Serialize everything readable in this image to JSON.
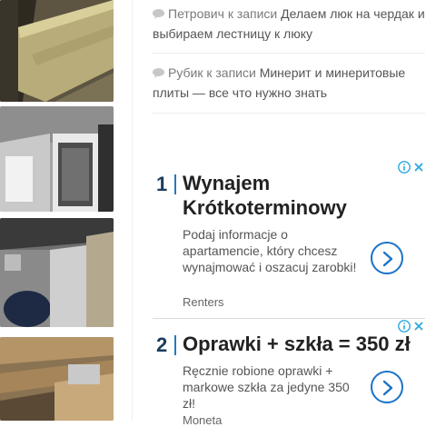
{
  "comments": [
    {
      "author": "Петрович",
      "connector": "к записи",
      "post_line1": "Делаем люк на чердак и",
      "post_line2": "выбираем лестницу к люку"
    },
    {
      "author": "Рубик",
      "connector": "к записи",
      "post_line1": "Минерит и минеритовые",
      "post_line2": "плиты — все что нужно знать"
    }
  ],
  "ads": [
    {
      "number": "1",
      "title_line1": "Wynajem",
      "title_line2": "Krótkoterminowy",
      "desc_line1": "Podaj informacje o",
      "desc_line2": "apartamencie, który chcesz",
      "desc_line3": "wynajmować i oszacuj zarobki!",
      "brand": "Renters",
      "info_icon": "info-icon",
      "close_icon": "close-icon",
      "go_icon": "chevron-right-icon"
    },
    {
      "number": "2",
      "title_line1": "Oprawki + szkła = 350 zł",
      "desc_line1": "Ręcznie robione oprawki +",
      "desc_line2": "markowe szkła za jedyne 350",
      "desc_line3": "zł!",
      "brand": "Moneta",
      "info_icon": "info-icon",
      "close_icon": "close-icon",
      "go_icon": "chevron-right-icon"
    }
  ],
  "colors": {
    "accent": "#1f7ac4",
    "chevron": "#1a72c8",
    "ad_info": "#29a8e0",
    "number": "#1a3b5d"
  }
}
